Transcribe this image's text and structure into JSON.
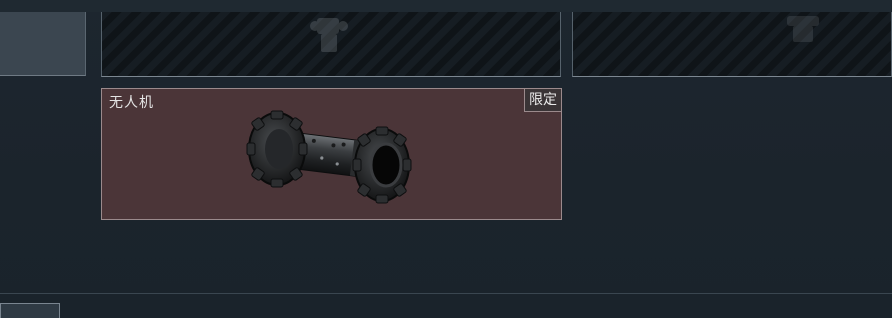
{
  "inventory": {
    "card": {
      "name": "无人机",
      "badge": "限定",
      "background_color": "#4b3538",
      "item_icon": "tracked-roller-drone"
    }
  },
  "colors": {
    "background": "#1c252e",
    "card_border": "#9b8a8c",
    "hatch_dark": "#0f1418"
  }
}
